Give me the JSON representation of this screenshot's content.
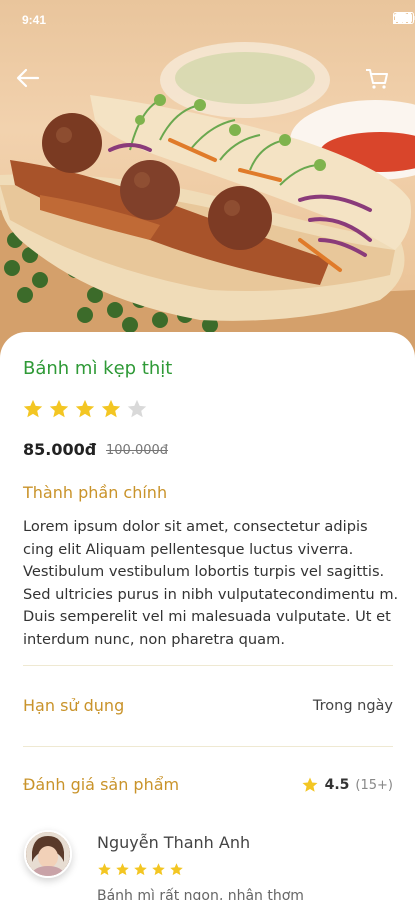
{
  "status_bar": {
    "time": "9:41"
  },
  "product": {
    "name": "Bánh mì kẹp thịt",
    "rating": 4,
    "rating_max": 5,
    "price": "85.000đ",
    "old_price": "100.000đ"
  },
  "ingredients": {
    "title": "Thành phần chính",
    "description": "Lorem ipsum dolor sit amet, consectetur adipis cing elit Aliquam pellentesque luctus viverra. Vestibulum vestibulum lobortis turpis vel sagittis. Sed ultricies purus in nibh vulputatecondimentu m. Duis semperelit vel mi malesuada vulputate. Ut et interdum nunc, non pharetra quam."
  },
  "expiry": {
    "label": "Hạn sử dụng",
    "value": "Trong ngày"
  },
  "reviews_summary": {
    "label": "Đánh giá sản phẩm",
    "average": "4.5",
    "count": "(15+)"
  },
  "review": {
    "name": "Nguyễn Thanh Anh",
    "stars": 5,
    "text": "Bánh mì rất ngon, nhân thơm"
  },
  "colors": {
    "title_green": "#2f9a37",
    "accent_gold": "#c9932a",
    "star_yellow": "#f3c623",
    "star_empty": "#d9d9d9"
  },
  "icons": [
    "back-arrow-icon",
    "cart-icon",
    "star-icon",
    "signal-icon",
    "wifi-icon",
    "battery-icon"
  ]
}
